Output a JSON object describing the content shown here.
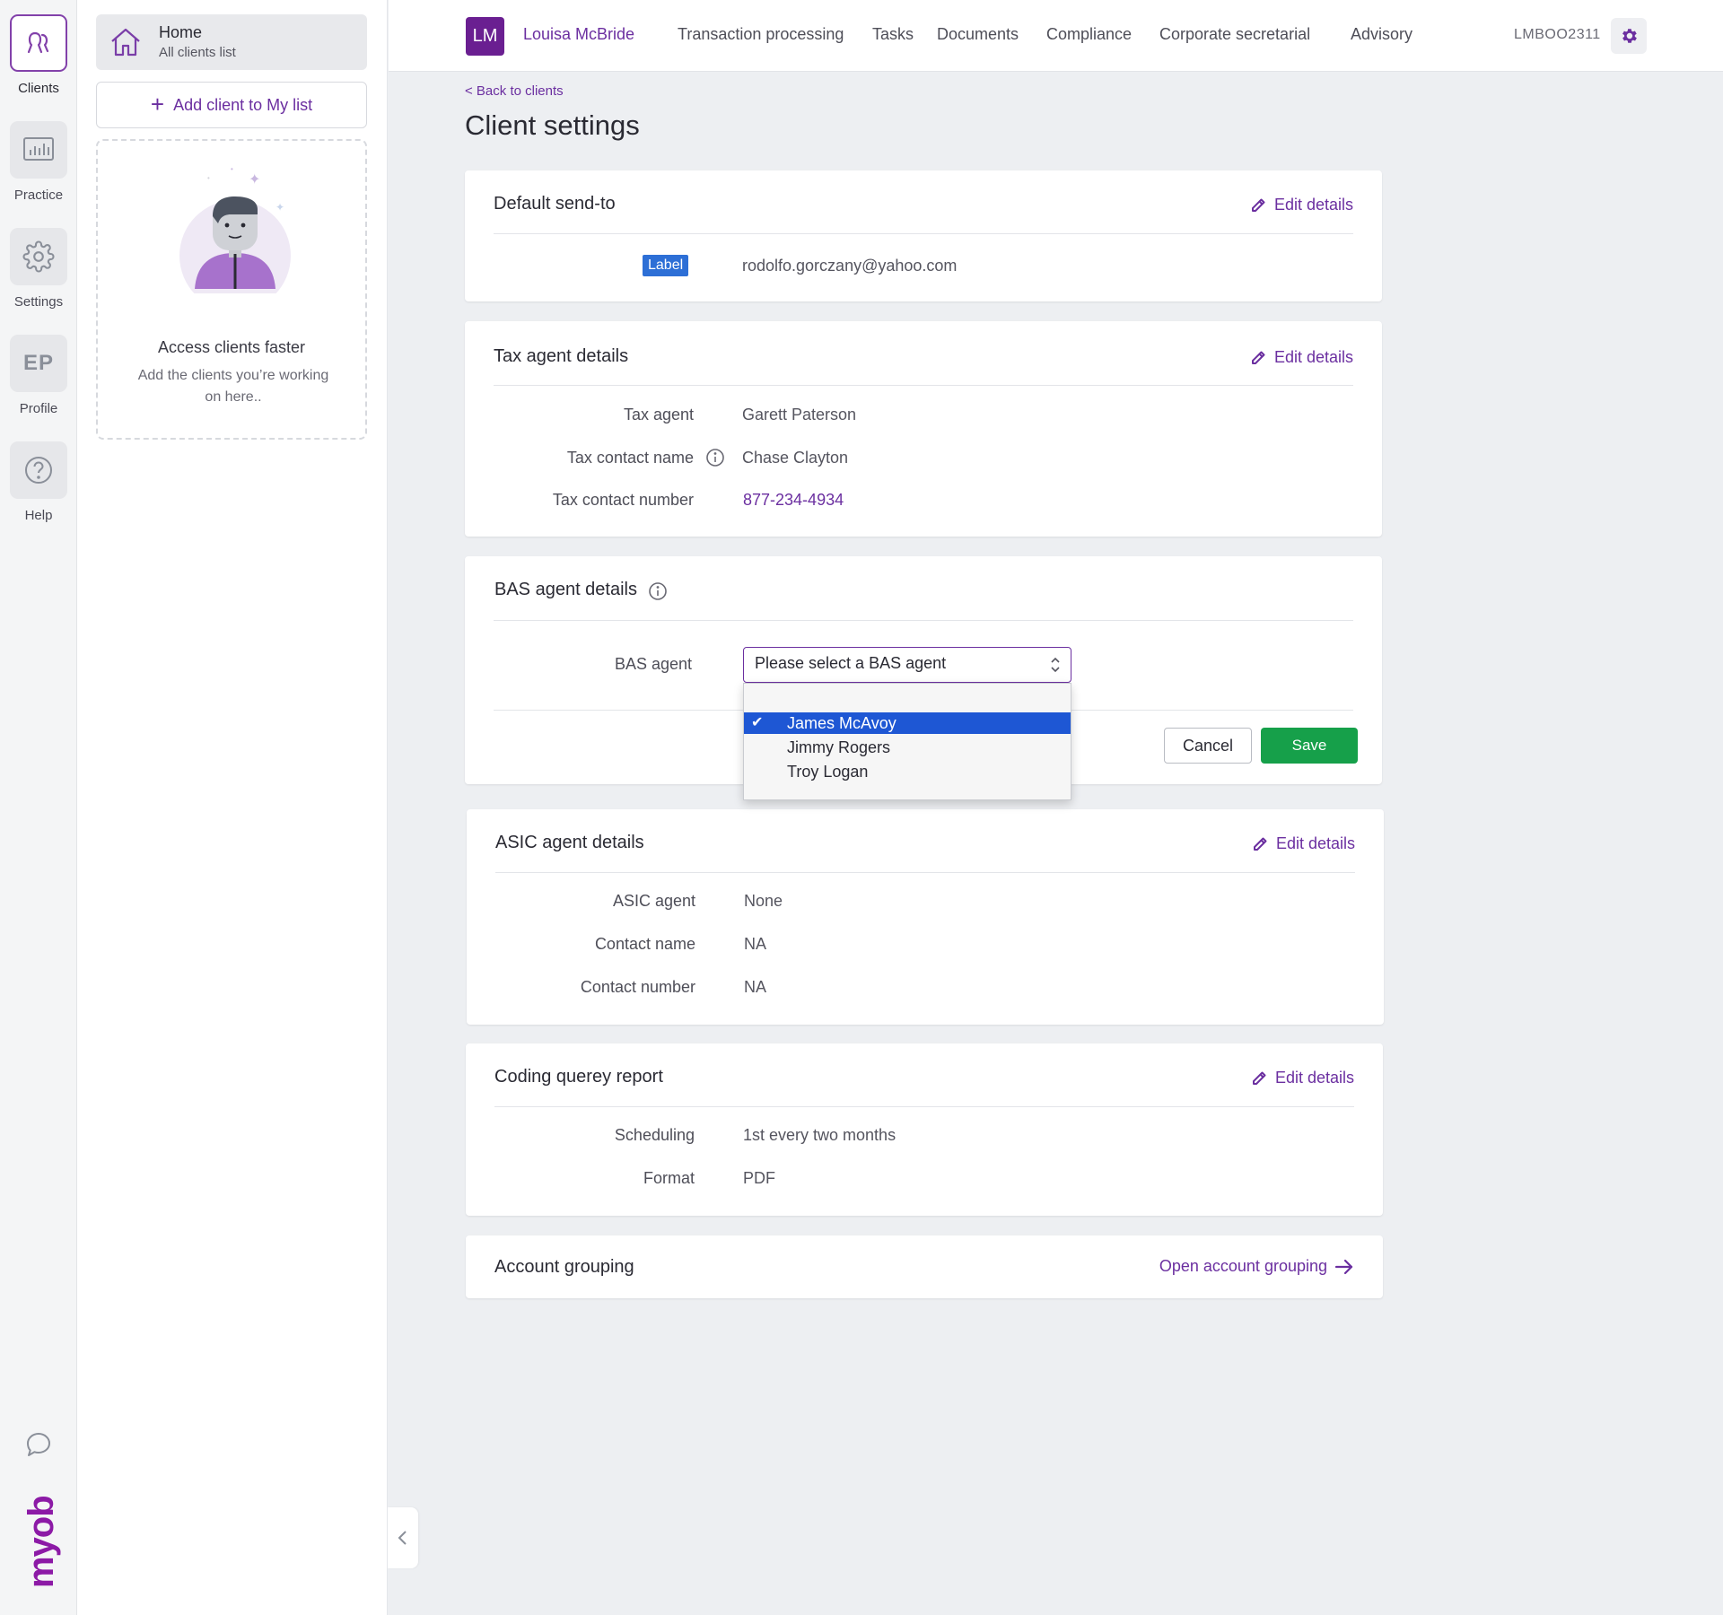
{
  "rail": {
    "items": [
      {
        "label": "Clients",
        "icon": "clients-icon"
      },
      {
        "label": "Practice",
        "icon": "practice-chart-icon"
      },
      {
        "label": "Settings",
        "icon": "gear-icon"
      },
      {
        "label": "Profile",
        "icon": "profile-initials",
        "initials": "EP"
      },
      {
        "label": "Help",
        "icon": "help-icon"
      }
    ],
    "chat_icon": "chat-bubble-icon",
    "logo": "myob"
  },
  "panel": {
    "home_title": "Home",
    "home_sub": "All clients list",
    "add_client_label": "Add client to My list",
    "empty_title": "Access clients faster",
    "empty_sub": "Add the clients you’re working on here.."
  },
  "topbar": {
    "avatar_initials": "LM",
    "user_name": "Louisa McBride",
    "nav": [
      "Transaction processing",
      "Tasks",
      "Documents",
      "Compliance",
      "Corporate secretarial",
      "Advisory"
    ],
    "account_code": "LMBOO2311"
  },
  "main": {
    "back_link": "< Back to clients",
    "page_title": "Client settings",
    "edit_label": "Edit details",
    "default_send_to": {
      "title": "Default send-to",
      "badge": "Label",
      "email": "rodolfo.gorczany@yahoo.com"
    },
    "tax_agent": {
      "title": "Tax agent details",
      "rows": [
        {
          "label": "Tax agent",
          "value": "Garett Paterson"
        },
        {
          "label": "Tax contact name",
          "value": "Chase Clayton"
        },
        {
          "label": "Tax contact number",
          "value": "877-234-4934"
        }
      ]
    },
    "bas_agent": {
      "title": "BAS agent details",
      "field_label": "BAS agent",
      "select_placeholder": "Please select a BAS agent",
      "options": [
        "James McAvoy",
        "Jimmy Rogers",
        "Troy Logan"
      ],
      "selected_index": 0,
      "cancel_label": "Cancel",
      "save_label": "Save"
    },
    "asic_agent": {
      "title": "ASIC agent details",
      "rows": [
        {
          "label": "ASIC agent",
          "value": "None"
        },
        {
          "label": "Contact name",
          "value": "NA"
        },
        {
          "label": "Contact number",
          "value": "NA"
        }
      ]
    },
    "coding_report": {
      "title": "Coding querey report",
      "rows": [
        {
          "label": "Scheduling",
          "value": "1st every two months"
        },
        {
          "label": "Format",
          "value": "PDF"
        }
      ]
    },
    "account_grouping": {
      "title": "Account grouping",
      "link": "Open account grouping"
    }
  },
  "colors": {
    "brand_purple": "#6b2fa0",
    "save_green": "#16a04a",
    "badge_blue": "#2d6fd6",
    "select_highlight": "#1e57d4"
  }
}
